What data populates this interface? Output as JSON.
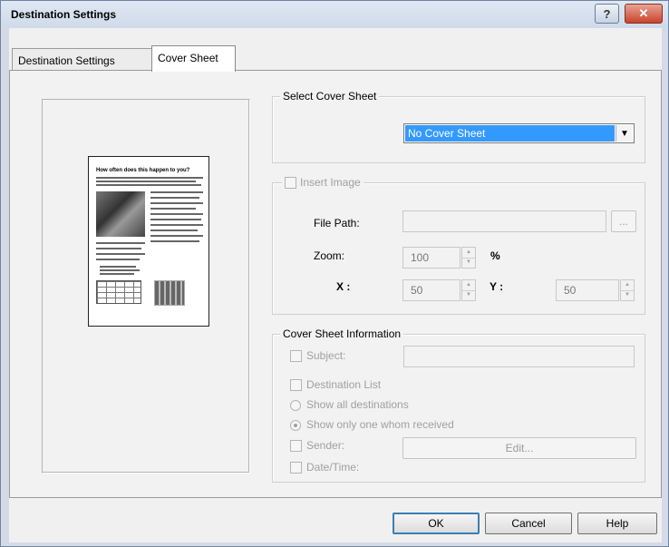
{
  "window": {
    "title": "Destination Settings",
    "help_glyph": "?",
    "close_glyph": "✕"
  },
  "tabs": [
    {
      "label": "Destination Settings",
      "active": false
    },
    {
      "label": "Cover Sheet",
      "active": true
    }
  ],
  "preview": {
    "headline": "How often does this happen to you?"
  },
  "select_cover_sheet": {
    "legend": "Select Cover Sheet",
    "selected": "No Cover Sheet",
    "arrow_glyph": "▼"
  },
  "insert_image": {
    "legend": "Insert Image",
    "checked": false,
    "file_path_label": "File Path:",
    "file_path_value": "",
    "browse_label": "...",
    "zoom_label": "Zoom:",
    "zoom_value": "100",
    "zoom_unit": "%",
    "x_label": "X :",
    "x_value": "50",
    "y_label": "Y :",
    "y_value": "50"
  },
  "cover_sheet_information": {
    "legend": "Cover Sheet Information",
    "subject_label": "Subject:",
    "subject_value": "",
    "destination_list_label": "Destination List",
    "show_all_label": "Show all destinations",
    "show_one_label": "Show only one whom received",
    "sender_label": "Sender:",
    "edit_label": "Edit...",
    "datetime_label": "Date/Time:"
  },
  "buttons": {
    "ok": "OK",
    "cancel": "Cancel",
    "help": "Help"
  }
}
